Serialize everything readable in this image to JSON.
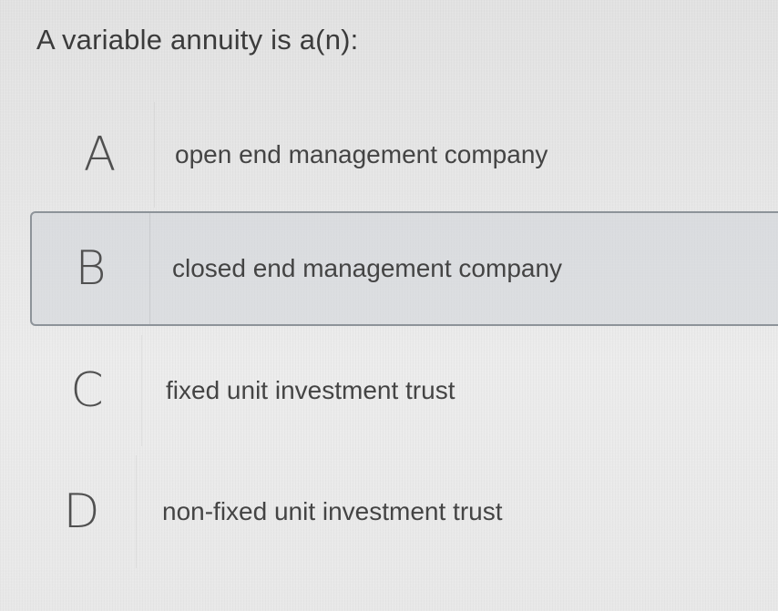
{
  "question": {
    "text": "A variable annuity is a(n):"
  },
  "options": [
    {
      "letter": "A",
      "text": "open end management company",
      "selected": false
    },
    {
      "letter": "B",
      "text": "closed end management company",
      "selected": true
    },
    {
      "letter": "C",
      "text": "fixed unit investment trust",
      "selected": false
    },
    {
      "letter": "D",
      "text": "non-fixed unit investment trust",
      "selected": false
    }
  ],
  "colors": {
    "background": "#e6e6e6",
    "selected_fill": "#d0d4d8",
    "selected_border": "#8d9399",
    "text": "#444444"
  }
}
